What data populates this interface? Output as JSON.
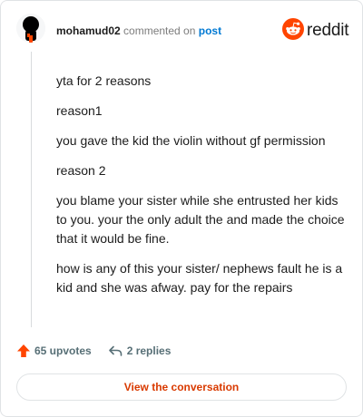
{
  "comment": {
    "username": "mohamud02",
    "action": "commented on",
    "post_link": "post",
    "avatar_icon": "user-avatar-icon",
    "paragraphs": [
      "yta for 2 reasons",
      "reason1",
      "you gave the kid the violin without gf permission",
      "reason 2",
      "you blame your sister while she entrusted her kids to you. your the only adult the and made the choice that it would be fine.",
      "how is any of this your sister/ nephews fault he is a kid and she was afway. pay for the repairs"
    ]
  },
  "brand": {
    "wordmark": "reddit",
    "icon": "reddit-logo-icon",
    "color": "#ff4500"
  },
  "footer": {
    "upvotes": "65 upvotes",
    "upvote_icon": "upvote-arrow-icon",
    "upvote_color": "#ff4500",
    "replies": "2 replies",
    "reply_icon": "reply-arrow-icon"
  },
  "cta": {
    "label": "View the conversation",
    "color": "#d93a00"
  }
}
